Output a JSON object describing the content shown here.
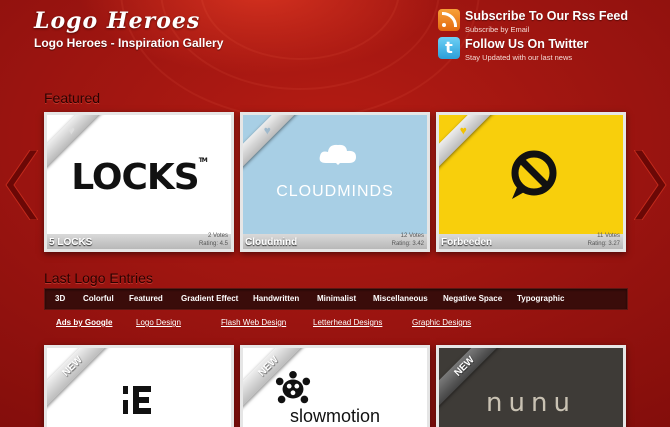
{
  "header": {
    "logo_text": "Logo Heroes",
    "tagline": "Logo Heroes - Inspiration Gallery"
  },
  "social": {
    "rss": {
      "icon": "rss-icon",
      "title": "Subscribe To Our Rss Feed",
      "sub": "Subscribe by Email"
    },
    "twitter": {
      "icon": "twitter-icon",
      "title": "Follow Us On Twitter",
      "sub": "Stay Updated with our last news"
    }
  },
  "featured": {
    "title": "Featured",
    "cards": [
      {
        "name": "5 LOCKS",
        "votes": "2 Votes",
        "rating": "Rating: 4.5",
        "logo_text": "LOCKS",
        "tm": "TM",
        "heart_color": "#dddddd"
      },
      {
        "name": "Cloudmind",
        "votes": "12 Votes",
        "rating": "Rating: 3.42",
        "logo_text": "CLOUDMINDS",
        "heart_color": "#9fb9cc"
      },
      {
        "name": "Forbeeden",
        "votes": "11 Votes",
        "rating": "Rating: 3.27",
        "heart_color": "#f2c200"
      }
    ]
  },
  "last_entries": {
    "title": "Last Logo Entries",
    "categories": [
      "3D",
      "Colorful",
      "Featured",
      "Gradient Effect",
      "Handwritten",
      "Minimalist",
      "Miscellaneous",
      "Negative Space",
      "Typographic"
    ],
    "links": [
      "Ads by Google",
      "Logo Design",
      "Flash Web Design",
      "Letterhead Designs",
      "Graphic Designs"
    ],
    "new_label": "NEW",
    "cards": [
      {
        "logo_text": "E"
      },
      {
        "logo_text": "slowmotion"
      },
      {
        "logo_text": "nunu"
      }
    ]
  },
  "colors": {
    "background": "#8a0e0b",
    "catbar": "#3a0c0a",
    "cloud_bg": "#a8cfe5",
    "forbeeden_bg": "#f8cf0c"
  }
}
